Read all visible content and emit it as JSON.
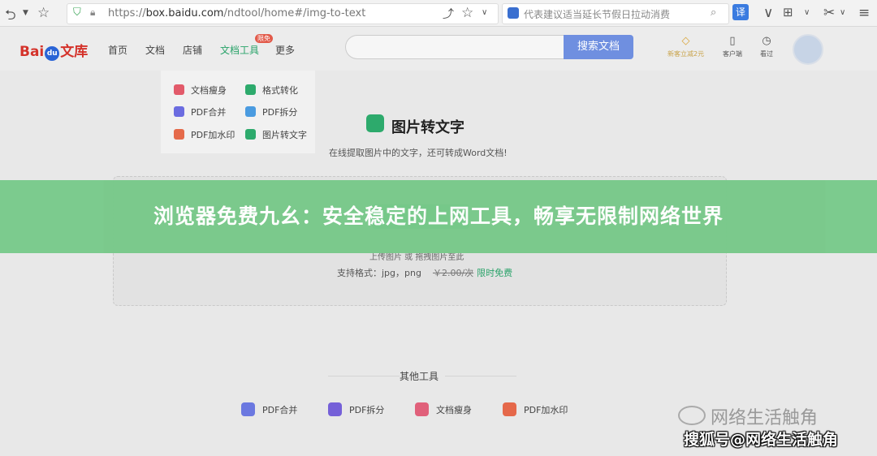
{
  "browser": {
    "url_prefix": "https://",
    "url_host": "box.baidu.com",
    "url_path": "/ndtool/home#/img-to-text",
    "ad_text": "代表建议适当延长节假日拉动消费",
    "translate_label": "译"
  },
  "site": {
    "logo_bai": "Bai",
    "logo_du": "du",
    "logo_wenku": "文库",
    "nav": [
      "首页",
      "文档",
      "店铺",
      "文档工具",
      "更多"
    ],
    "nav_badge": "限免",
    "search_button": "搜索文档",
    "right_icons": [
      {
        "label": "新客立减2元"
      },
      {
        "label": "客户端"
      },
      {
        "label": "看过"
      }
    ]
  },
  "dropdown": {
    "items": [
      "文档瘦身",
      "格式转化",
      "PDF合并",
      "PDF拆分",
      "PDF加水印",
      "图片转文字"
    ]
  },
  "hero": {
    "title": "图片转文字",
    "subtitle": "在线提取图片中的文字，还可转成Word文档!"
  },
  "upload": {
    "hint": "上传图片 或 拖拽图片至此",
    "formats": "支持格式：jpg，png",
    "price": "￥2.00/次",
    "free": "限时免费"
  },
  "banner": {
    "text": "浏览器免费九幺：安全稳定的上网工具，畅享无限制网络世界"
  },
  "other_tools": {
    "title": "其他工具",
    "items": [
      "PDF合并",
      "PDF拆分",
      "文档瘦身",
      "PDF加水印"
    ]
  },
  "watermark": {
    "line1": "网络生活触角",
    "line2": "搜狐号@网络生活触角"
  }
}
